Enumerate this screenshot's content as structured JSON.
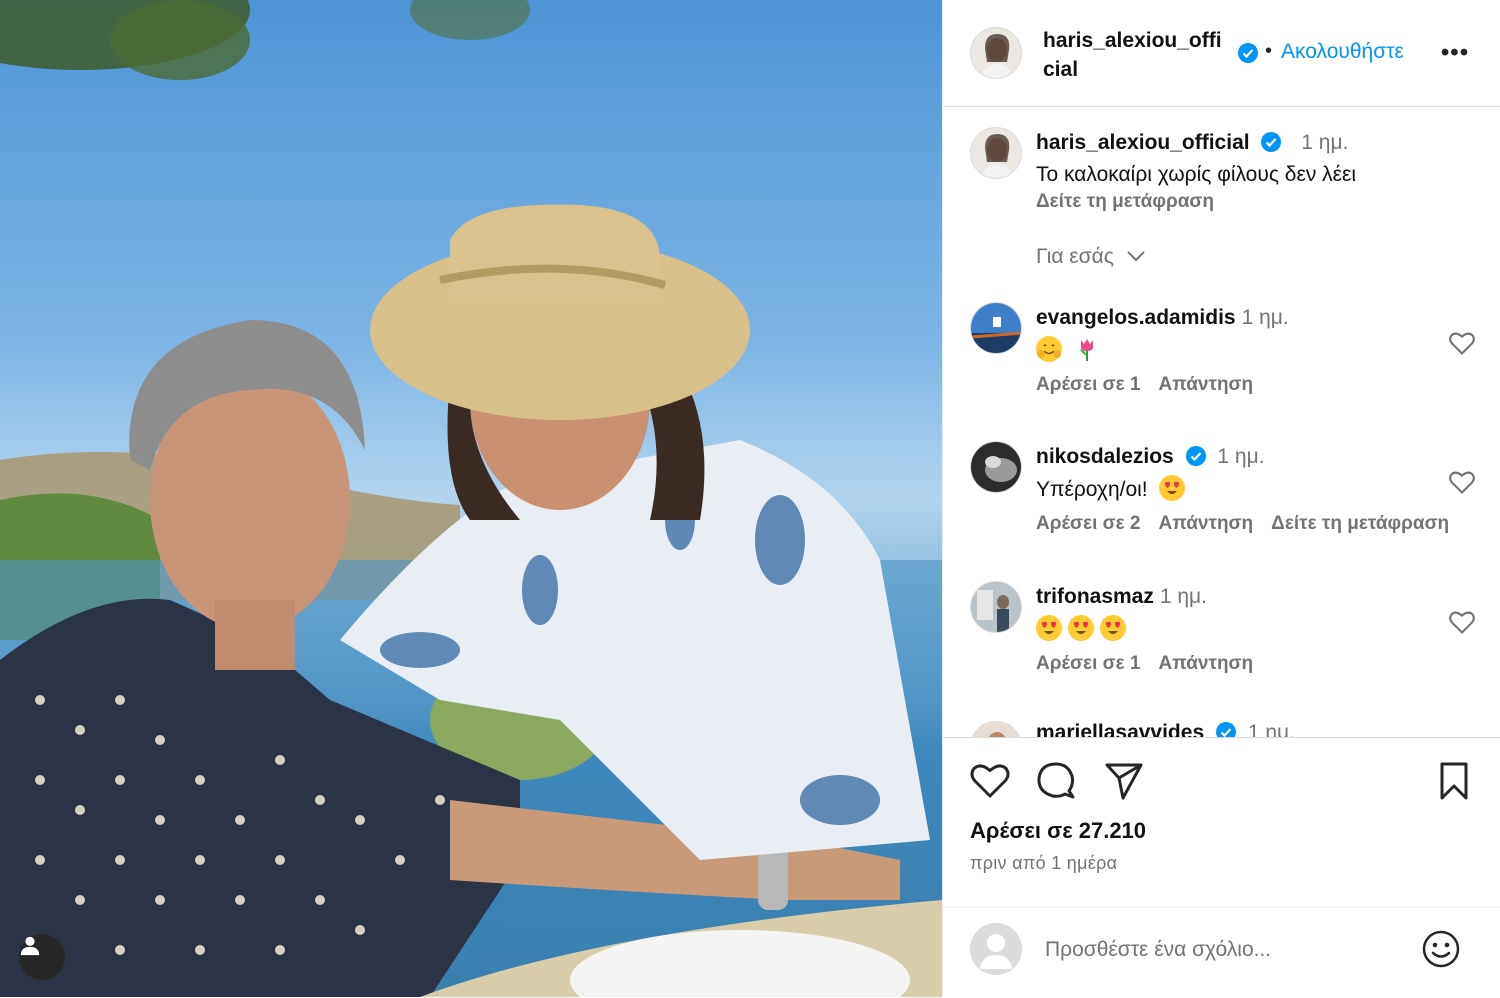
{
  "header": {
    "username": "haris_alexiou_official",
    "separator": "•",
    "follow_label": "Ακολουθήστε",
    "more_icon": "more-horizontal-icon"
  },
  "caption": {
    "username": "haris_alexiou_official",
    "time": "1 ημ.",
    "text": "Το καλοκαίρι χωρίς φίλους δεν λέει",
    "translate_label": "Δείτε τη μετάφραση"
  },
  "filter_label": "Για εσάς",
  "comments": [
    {
      "username": "evangelos.adamidis",
      "time": "1 ημ.",
      "emojis": [
        "🤗",
        "🌷"
      ],
      "likes_label": "Αρέσει σε 1",
      "reply_label": "Απάντηση"
    },
    {
      "username": "nikosdalezios",
      "time": "1 ημ.",
      "text": "Υπέροχη/οι!",
      "emojis": [
        "😍"
      ],
      "likes_label": "Αρέσει σε 2",
      "reply_label": "Απάντηση",
      "translate_label": "Δείτε τη μετάφραση"
    },
    {
      "username": "trifonasmaz",
      "time": "1 ημ.",
      "emojis": [
        "😍",
        "😍",
        "😍"
      ],
      "likes_label": "Αρέσει σε 1",
      "reply_label": "Απάντηση"
    },
    {
      "username": "mariellasavvides",
      "time": "1 ημ."
    }
  ],
  "likes_text": "Αρέσει σε 27.210",
  "posted_ago": "πριν από 1 ημέρα",
  "add_comment": {
    "placeholder": "Προσθέστε ένα σχόλιο..."
  },
  "colors": {
    "link_blue": "#0095f6",
    "verified_blue": "#0095f6",
    "muted_text": "#737373",
    "border": "#dbdbdb"
  }
}
